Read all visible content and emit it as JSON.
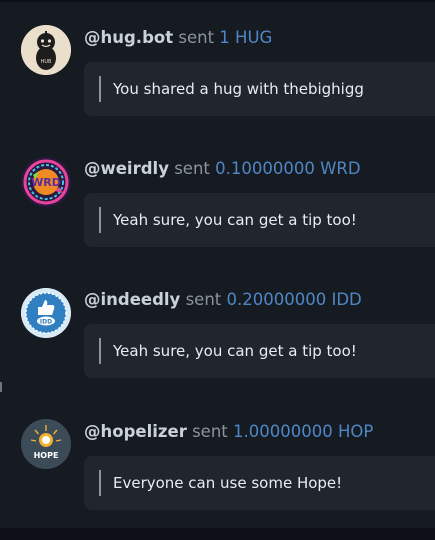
{
  "messages": [
    {
      "handle": "@hug.bot",
      "verb": "sent",
      "amount": "1 HUG",
      "text": "You shared a hug with thebighigg",
      "avatar_label": "HUB",
      "avatar_icon": "hug-bot-avatar-icon"
    },
    {
      "handle": "@weirdly",
      "verb": "sent",
      "amount": "0.10000000 WRD",
      "text": "Yeah sure, you can get a tip too!",
      "avatar_label": "WRD",
      "avatar_icon": "weirdly-avatar-icon"
    },
    {
      "handle": "@indeedly",
      "verb": "sent",
      "amount": "0.20000000 IDD",
      "text": "Yeah sure, you can get a tip too!",
      "avatar_label": "IDD",
      "avatar_icon": "indeedly-avatar-icon"
    },
    {
      "handle": "@hopelizer",
      "verb": "sent",
      "amount": "1.00000000 HOP",
      "text": "Everyone can use some Hope!",
      "avatar_label": "HOPE",
      "avatar_icon": "hopelizer-avatar-icon"
    }
  ],
  "colors": {
    "background": "#161b22",
    "bubble": "#21262d",
    "handle": "#c9d1d9",
    "verb": "#8b949e",
    "amount": "#4f86c6",
    "text": "#e6edf3"
  }
}
